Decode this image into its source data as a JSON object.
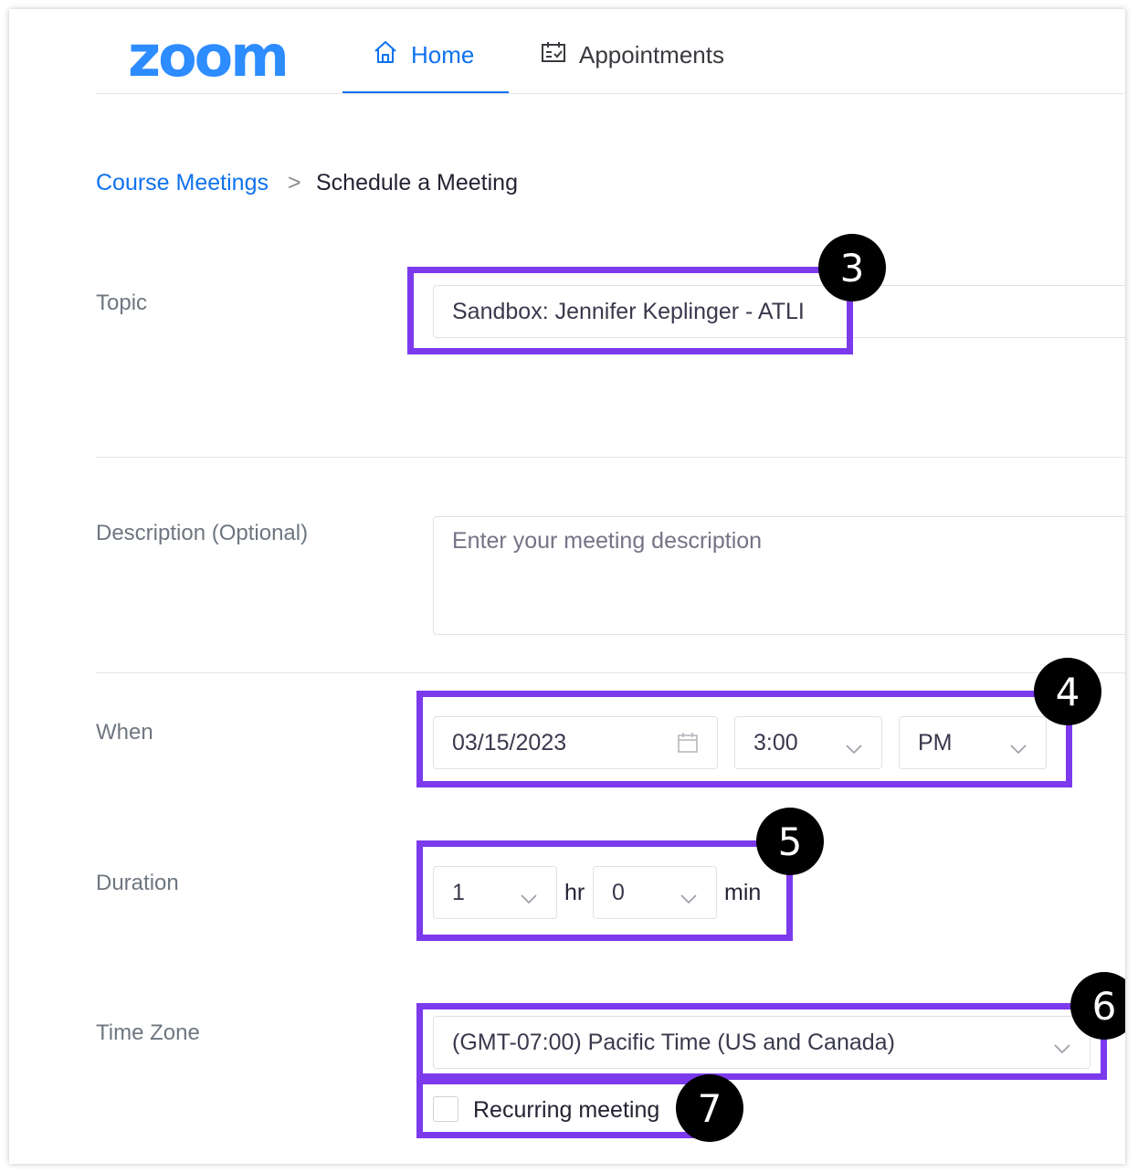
{
  "app": {
    "logo": "zoom"
  },
  "nav": {
    "home_label": "Home",
    "appointments_label": "Appointments"
  },
  "breadcrumb": {
    "parent": "Course Meetings",
    "separator": ">",
    "current": "Schedule a Meeting"
  },
  "form": {
    "topic": {
      "label": "Topic",
      "value": "Sandbox: Jennifer Keplinger - ATLI"
    },
    "description": {
      "label": "Description (Optional)",
      "placeholder": "Enter your meeting description"
    },
    "when": {
      "label": "When",
      "date": "03/15/2023",
      "time": "3:00",
      "ampm": "PM"
    },
    "duration": {
      "label": "Duration",
      "hours": "1",
      "hours_unit": "hr",
      "minutes": "0",
      "minutes_unit": "min"
    },
    "timezone": {
      "label": "Time Zone",
      "value": "(GMT-07:00) Pacific Time (US and Canada)"
    },
    "recurring": {
      "label": "Recurring meeting",
      "checked": false
    }
  },
  "annotations": {
    "step_topic": "3",
    "step_when": "4",
    "step_duration": "5",
    "step_timezone": "6",
    "step_recurring": "7",
    "highlight_color": "#7c3aed"
  },
  "colors": {
    "brand": "#2d8cff",
    "link": "#0e72ed"
  }
}
